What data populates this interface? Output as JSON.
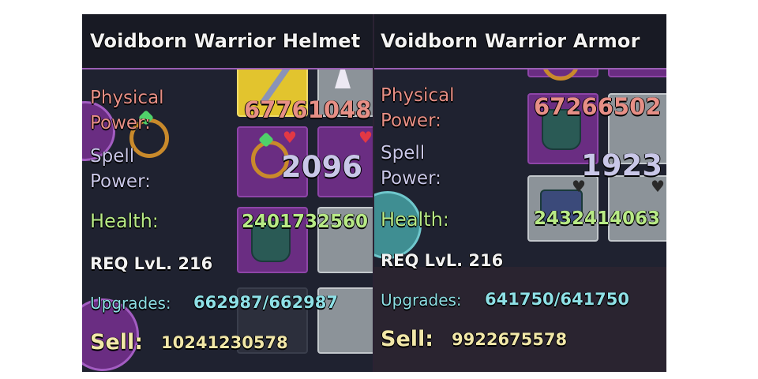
{
  "items": [
    {
      "title": "Voidborn Warrior Helmet",
      "physical_label": "Physical\nPower:",
      "physical_value": "67761048",
      "spell_label": "Spell\nPower:",
      "spell_value": "2096",
      "health_label": "Health:",
      "health_value": "2401732560",
      "req_level": "REQ LvL. 216",
      "upgrades_label": "Upgrades:",
      "upgrades_value": "662987/662987",
      "sell_label": "Sell:",
      "sell_value": "10241230578"
    },
    {
      "title": "Voidborn Warrior Armor",
      "physical_label": "Physical\nPower:",
      "physical_value": "67266502",
      "spell_label": "Spell\nPower:",
      "spell_value": "1923",
      "health_label": "Health:",
      "health_value": "2432414063",
      "req_level": "REQ LvL. 216",
      "upgrades_label": "Upgrades:",
      "upgrades_value": "641750/641750",
      "sell_label": "Sell:",
      "sell_value": "9922675578"
    }
  ],
  "colors": {
    "physical": "#e78f86",
    "spell": "#c9c7e8",
    "health": "#b8ea86",
    "upgrades": "#8ee0e6",
    "sell": "#f1e7a8",
    "accent_border": "#9b5fb5",
    "panel_bg": "#1f2230"
  },
  "icons": [
    "heart-icon",
    "ring-icon",
    "orb-icon",
    "armor-icon",
    "spike-icon",
    "staff-icon"
  ]
}
